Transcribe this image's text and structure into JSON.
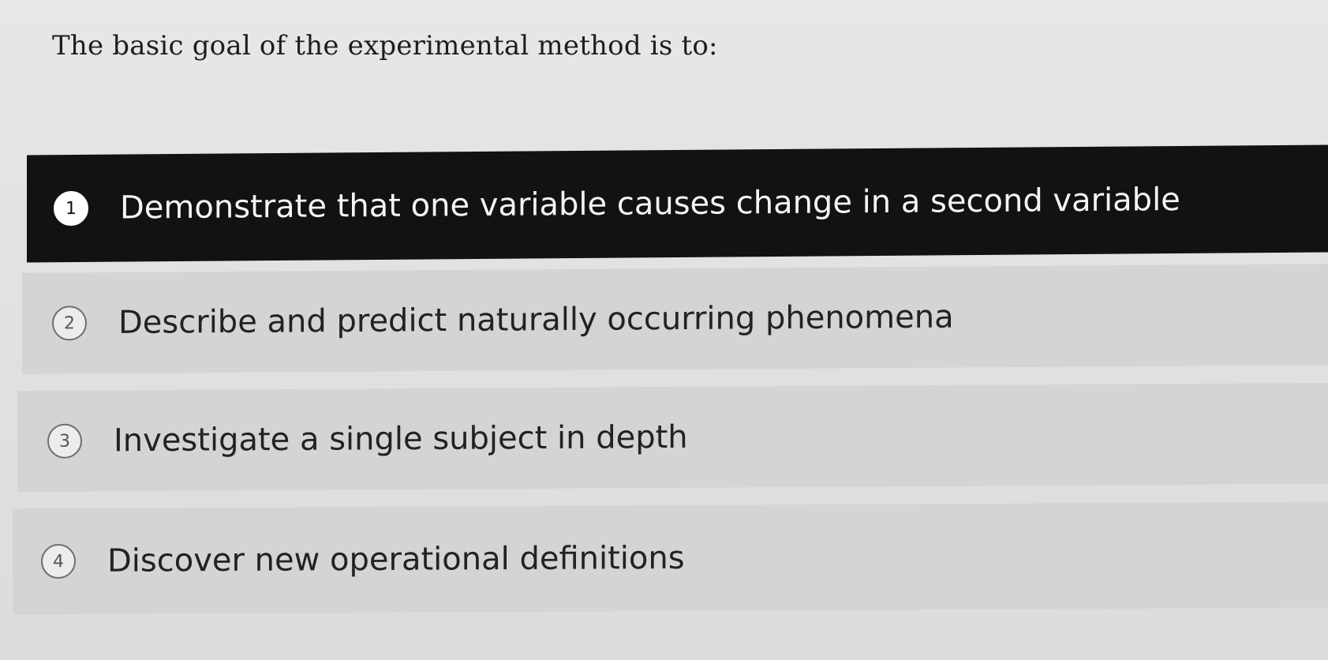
{
  "question": {
    "text": "The basic goal of the experimental method is to:"
  },
  "options": [
    {
      "number": "1",
      "label": "Demonstrate that one variable causes change in a second variable",
      "selected": true
    },
    {
      "number": "2",
      "label": "Describe and predict naturally occurring phenomena",
      "selected": false
    },
    {
      "number": "3",
      "label": "Investigate a single subject in depth",
      "selected": false
    },
    {
      "number": "4",
      "label": "Discover new operational definitions",
      "selected": false
    }
  ],
  "colors": {
    "selected_background": "#121212",
    "option_background": "#d4d4d2",
    "page_background": "#e4e4e2"
  }
}
